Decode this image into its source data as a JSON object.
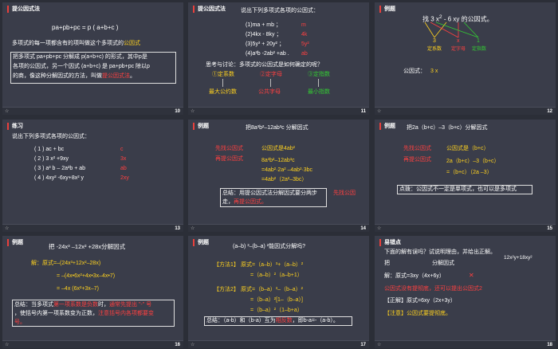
{
  "slides": [
    {
      "num": "10",
      "title": "提公因式法",
      "formula": "pa+pb+pc = p ( a+b+c )",
      "line1a": "多项式的每一项都含有的项叫做这个多项式的",
      "line1b": "公因式",
      "box1": "把多项式 pa+pb+pc 分解成 p(a+b+c) 的形式，其中p是",
      "box2": "各项的公因式，另一个因式 (a+b+c) 是 pa+pb+pc 除以p",
      "box3a": "的商，像这种分解因式的方法，叫做",
      "box3b": "提公因式法",
      "box3c": "。"
    },
    {
      "num": "11",
      "title": "提公因式法",
      "intro": "说出下列多项式各项的公因式：",
      "items": [
        {
          "expr": "(1)ma + mb ；",
          "ans": "m"
        },
        {
          "expr": "(2)4kx - 8ky ；",
          "ans": "4k"
        },
        {
          "expr": "(3)5y³ + 20y² ；",
          "ans": "5y²"
        },
        {
          "expr": "(4)a²b -2ab² +ab .",
          "ans": "ab"
        }
      ],
      "think": "思考与讨论：多项式的公因式是如何确定的呢？",
      "step1": "①定系数",
      "step2": "②定字母",
      "step3": "③定指数",
      "res1": "最大公约数",
      "res2": "公共字母",
      "res3": "最小指数"
    },
    {
      "num": "12",
      "title": "例题",
      "q_pre": "找 3",
      "q_x": "x",
      "q_mid": "- 6",
      "q_xy": "xy",
      "q_post": "的公因式。",
      "lbl_num": "3",
      "lbl_x": "x",
      "lbl_one": "1",
      "cap1": "定系数",
      "cap2": "定字母",
      "cap3": "定指数",
      "ans_label": "公因式：",
      "ans_val": "3 x"
    },
    {
      "num": "13",
      "title": "练习",
      "intro": "说出下列多项式各项的公因式：",
      "items": [
        {
          "expr": "( 1 ) ac + bc",
          "ans": "c"
        },
        {
          "expr": "( 2 ) 3 x² +9xy",
          "ans": "3x"
        },
        {
          "expr": "( 3 ) a³ b – 2a²b  + ab",
          "ans": "ab"
        },
        {
          "expr": "( 4 ) 4xy² -6xy+8x² y",
          "ans": "2xy"
        }
      ]
    },
    {
      "num": "14",
      "title": "例题",
      "q": "把8a³b²–12ab³c 分解因式",
      "s1": "先找公因式",
      "s1v": "公因式是4ab²",
      "s2": "再提公因式",
      "e1": "8a³b²–12ab³c",
      "e2": "=4ab²·2a² –4ab²·3bc",
      "e3": "=4ab²（2a²–3bc）",
      "sum1": "总结：用提公因式法分解因式要分两步",
      "sum2": "走，",
      "sum2r": "再提公因式。",
      "side": "先找公因"
    },
    {
      "num": "15",
      "title": "例题",
      "q": "把2a（b+c）–3（b+c）分解因式",
      "s1": "先找公因式",
      "s1v": "公因式是（b+c）",
      "s2": "再提公因式",
      "e1": "2a（b+c）–3（b+c）",
      "e2": "=（b+c）（2a –3）",
      "note": "点拨：公因式不一定是单项式，也可以是多项式"
    },
    {
      "num": "16",
      "title": "例题",
      "q": "把 -24x³ –12x² +28x分解因式",
      "l1a": "解：原式=",
      "l1b": "–(24x³+12x²–28x)",
      "l2": "= –(4x•6x²+4x•3x–4x•7)",
      "l3": "= –4x (6x²+3x–7)",
      "sum1a": "总结：当多项式",
      "sum1b": "第一项系数是负数",
      "sum1c": "时，",
      "sum1d": "通常先提出 \"-\" 号",
      "sum2a": "，使括号内第一项系数变为正数，",
      "sum2b": "注意括号内各项都要变",
      "sum3": "号。"
    },
    {
      "num": "17",
      "title": "例题",
      "q": "(a–b) ³–(b–a) ²能因式分解吗?",
      "m1": "【方法1】",
      "m1e1": "原式=（a–b）³+（a–b）²",
      "m1e2": "=（a–b）²（a–b+1）",
      "m2": "【方法2】",
      "m2e1": "原式=（b–a）³–（b–a）²",
      "m2e2": "=（b–a）²[1–（b–a）]",
      "m2e3": "=（b–a）²（1–b+a）",
      "sum_a": "总结：（a-b）和（b-a）互为",
      "sum_b": "相反数",
      "sum_c": "，即b-a=-（a-b）。"
    },
    {
      "num": "18",
      "title": "易错点",
      "q1": "下面的解有误吗？试说明理由，并给出正解。",
      "q_expr": "12x²y+18xy²",
      "q2a": "把",
      "q2b": "分解因式",
      "sol": "解：原式=3xy（4x+6y）",
      "cross": "✕",
      "reason": "公因式没有提彻底，还可以提出公因式2",
      "fix": "【正解】原式=6xy（2x+3y）",
      "note": "【注意】公因式要提彻底。"
    }
  ],
  "footer_icon": "☆"
}
